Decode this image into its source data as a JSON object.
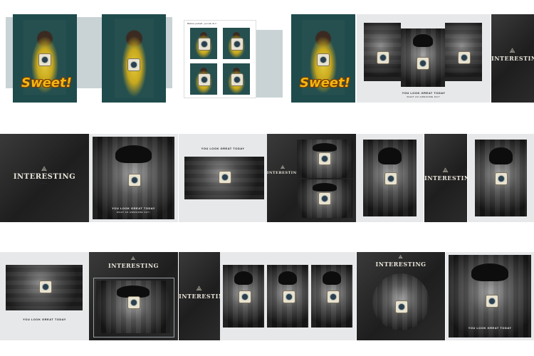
{
  "spread1": {
    "title": "Sweet!"
  },
  "spread2": {
    "heading": "Believe yourself , you can do it"
  },
  "spread3": {
    "title": "Sweet!",
    "caption_main": "YOU LOOK GREAT TODAY",
    "caption_sub": "WHAT AN AWESOME DAY!",
    "logo_title": "INTERESTING"
  },
  "spread4": {
    "logo_title": "INTERESTING",
    "caption_main": "YOU LOOK GREAT TODAY",
    "caption_sub": "WHAT AN AWESOME DAY!"
  },
  "spread5": {
    "heading": "YOU LOOK GREAT TODAY",
    "logo_title": "INTERESTING"
  },
  "spread6": {
    "logo_title": "INTERESTING"
  },
  "spread7": {
    "caption_main": "YOU LOOK GREAT TODAY",
    "logo_title": "INTERESTING"
  },
  "spread8": {
    "logo_title": "INTERESTING"
  },
  "spread9": {
    "logo_title": "INTERESTING",
    "caption_main": "YOU LOOK GREAT TODAY"
  },
  "colors": {
    "teal": "#1f4b4c",
    "yellow": "#f0b614",
    "dark": "#262626",
    "light": "#e7e8ea"
  }
}
